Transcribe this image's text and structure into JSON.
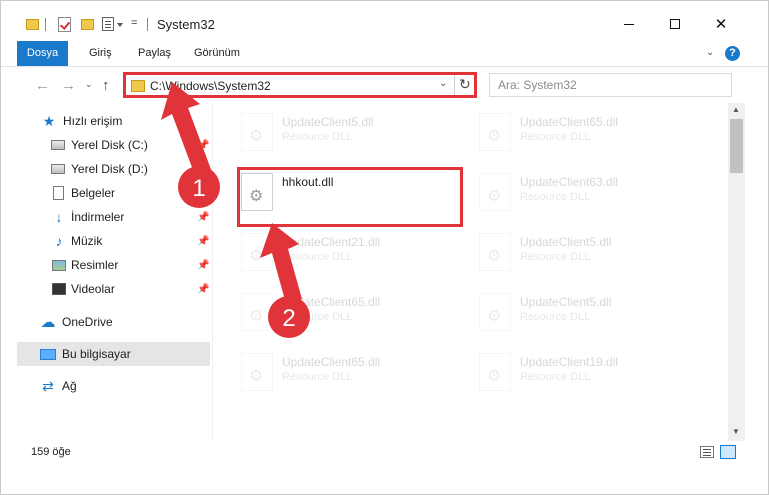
{
  "window": {
    "title": "System32",
    "qa_more": "=",
    "controls": {
      "minimize": "—",
      "maximize": "",
      "close": "✕"
    }
  },
  "ribbon": {
    "tabs": [
      "Dosya",
      "Giriş",
      "Paylaş",
      "Görünüm"
    ],
    "collapse": "⌄",
    "help": "?"
  },
  "nav": {
    "back": "←",
    "forward": "→",
    "recent": "⌄",
    "up": "↑",
    "address": "C:\\Windows\\System32",
    "address_drop": "⌄",
    "refresh": "↻",
    "search_placeholder": "Ara: System32"
  },
  "sidebar": {
    "quick_access": "Hızlı erişim",
    "items": [
      {
        "label": "Yerel Disk (C:)",
        "icon": "drive-icon",
        "pinned": true
      },
      {
        "label": "Yerel Disk (D:)",
        "icon": "drive-icon",
        "pinned": true
      },
      {
        "label": "Belgeler",
        "icon": "document-icon",
        "pinned": true
      },
      {
        "label": "İndirmeler",
        "icon": "download-icon",
        "pinned": true
      },
      {
        "label": "Müzik",
        "icon": "music-icon",
        "pinned": true
      },
      {
        "label": "Resimler",
        "icon": "pictures-icon",
        "pinned": true
      },
      {
        "label": "Videolar",
        "icon": "video-icon",
        "pinned": true
      }
    ],
    "onedrive": "OneDrive",
    "this_pc": "Bu bilgisayar",
    "network": "Ağ",
    "pin_glyph": "📌"
  },
  "files": {
    "selected": {
      "name": "hhkout.dll"
    },
    "left_column": [
      {
        "name": "UpdateClient5.dll",
        "desc": "Resource DLL"
      },
      {
        "name": "UpdateClient21.dll",
        "desc": "Resource DLL"
      },
      {
        "name": "UpdateClient65.dll",
        "desc": "Resource DLL"
      },
      {
        "name": "UpdateClient65.dll",
        "desc": "Resource DLL"
      }
    ],
    "right_column": [
      {
        "name": "UpdateClient65.dll",
        "desc": "Resource DLL"
      },
      {
        "name": "UpdateClient63.dll",
        "desc": "Resource DLL"
      },
      {
        "name": "UpdateClient5.dll",
        "desc": "Resource DLL"
      },
      {
        "name": "UpdateClient5.dll",
        "desc": "Resource DLL"
      },
      {
        "name": "UpdateClient19.dll",
        "desc": "Resource DLL"
      }
    ]
  },
  "scrollbar": {
    "up": "▲",
    "down": "▼"
  },
  "status": {
    "count": "159 öğe"
  },
  "annotations": {
    "step1": "1",
    "step2": "2",
    "color": "#e0333a"
  }
}
